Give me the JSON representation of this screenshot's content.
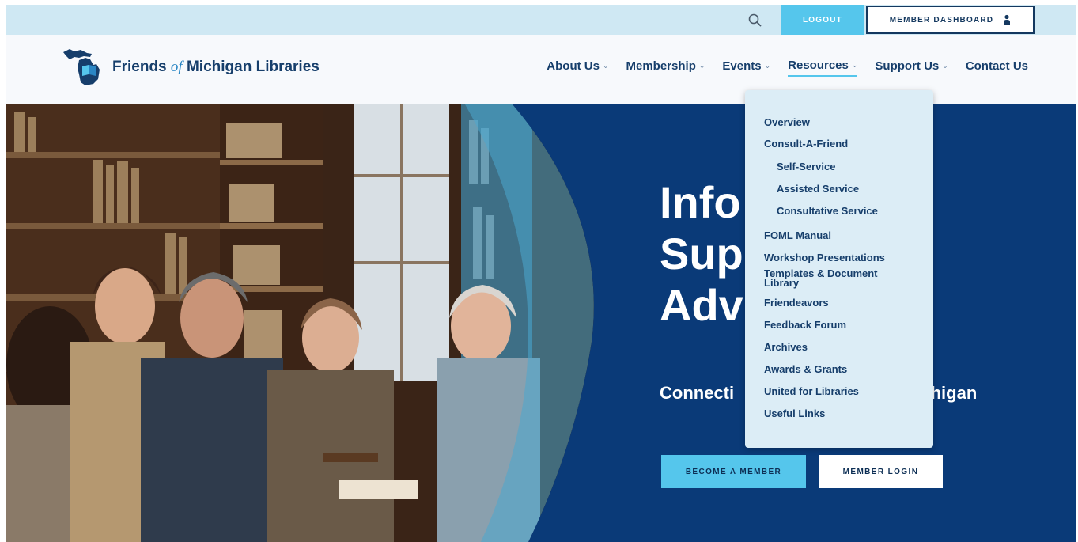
{
  "topbar": {
    "search_icon": "search-icon",
    "logout_label": "LOGOUT",
    "dashboard_label": "MEMBER DASHBOARD",
    "dashboard_icon": "person-icon"
  },
  "header": {
    "logo_part1": "Friends ",
    "logo_part2": "of",
    "logo_part3": " Michigan Libraries",
    "nav": [
      {
        "label": "About Us"
      },
      {
        "label": "Membership"
      },
      {
        "label": "Events"
      },
      {
        "label": "Resources"
      },
      {
        "label": "Support Us"
      },
      {
        "label": "Contact Us"
      }
    ]
  },
  "dropdown": {
    "items": [
      {
        "label": "Overview",
        "sub": false
      },
      {
        "label": "Consult-A-Friend",
        "sub": false
      },
      {
        "label": "Self-Service",
        "sub": true
      },
      {
        "label": "Assisted Service",
        "sub": true
      },
      {
        "label": "Consultative Service",
        "sub": true
      },
      {
        "label": "FOML Manual",
        "sub": false
      },
      {
        "label": "Workshop Presentations",
        "sub": false
      },
      {
        "label": "Templates & Document Library",
        "sub": false
      },
      {
        "label": "Friendeavors",
        "sub": false
      },
      {
        "label": "Feedback Forum",
        "sub": false
      },
      {
        "label": "Archives",
        "sub": false
      },
      {
        "label": "Awards & Grants",
        "sub": false
      },
      {
        "label": "United for Libraries",
        "sub": false
      },
      {
        "label": "Useful Links",
        "sub": false
      }
    ]
  },
  "hero": {
    "title_lines": [
      "Info",
      "Sup",
      "Adv"
    ],
    "subtitle_visible_left": "Connecti",
    "subtitle_visible_right": "chigan",
    "become_member_label": "BECOME A MEMBER",
    "member_login_label": "MEMBER LOGIN"
  },
  "colors": {
    "navy": "#163e6b",
    "hero_blue": "#0a3a78",
    "accent": "#55c6ec",
    "topbar": "#cfe8f3",
    "dropdown_bg": "#dcedf6"
  }
}
